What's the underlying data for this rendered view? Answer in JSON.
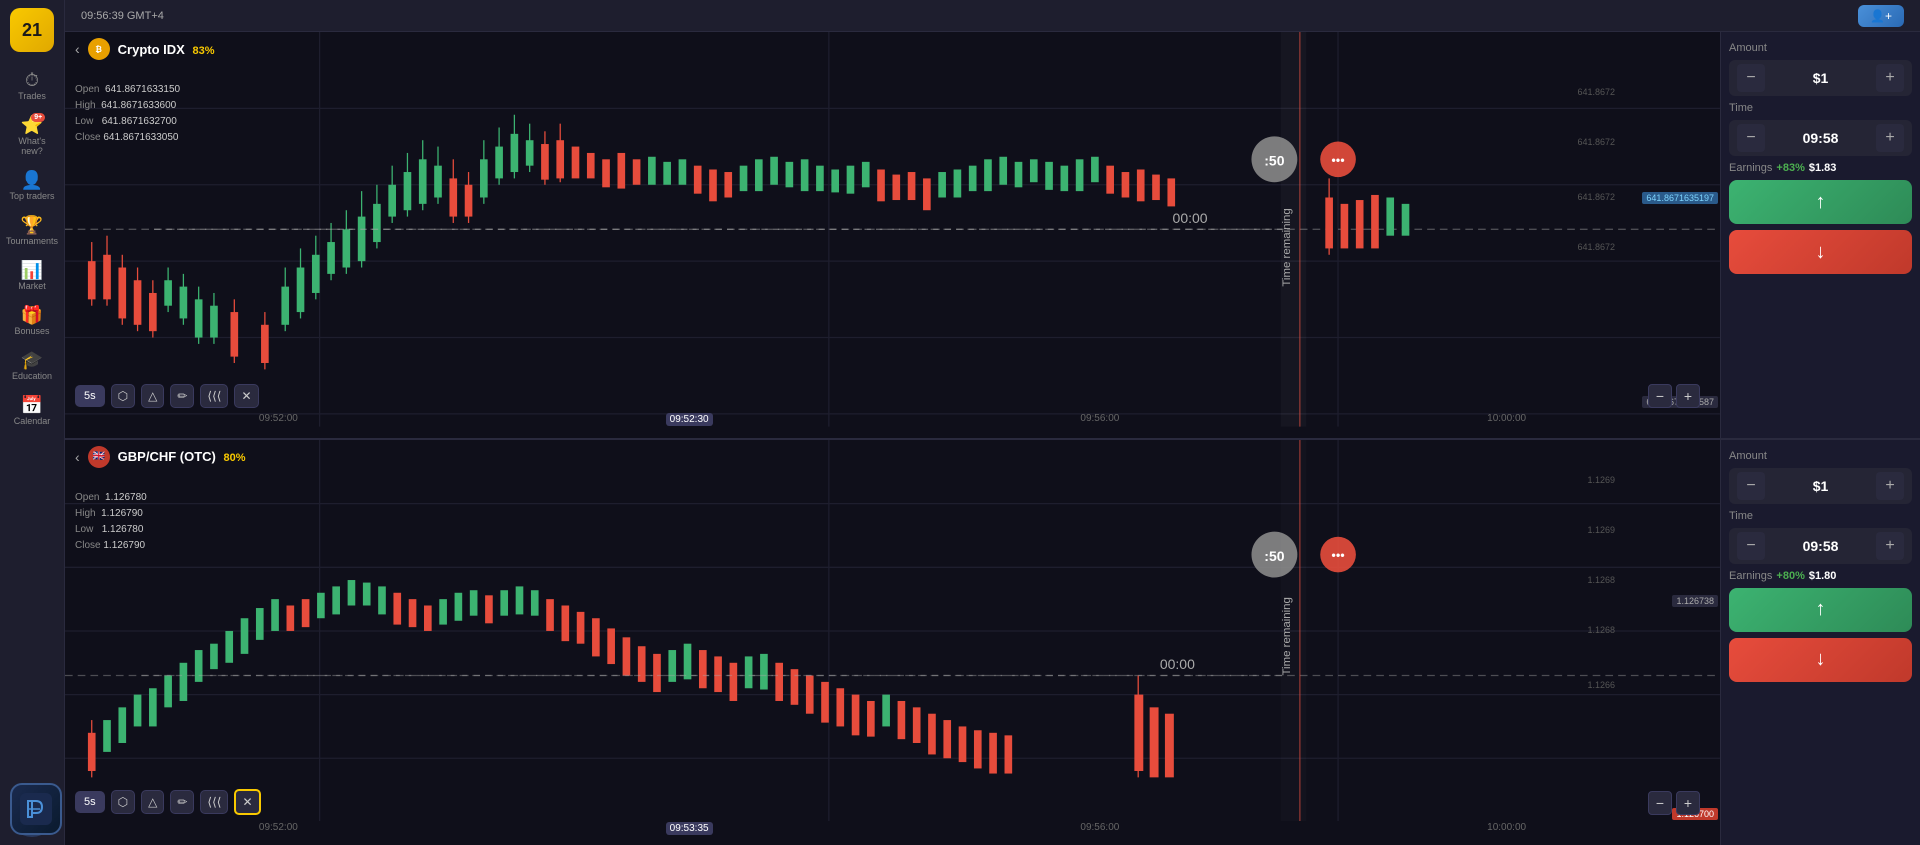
{
  "topbar": {
    "time": "09:56:39 GMT+4"
  },
  "sidebar": {
    "logo": "21",
    "items": [
      {
        "id": "trades",
        "label": "Trades",
        "icon": "⏱"
      },
      {
        "id": "whats-new",
        "label": "What's new?",
        "icon": "⭐",
        "badge": "9+"
      },
      {
        "id": "top-traders",
        "label": "Top traders",
        "icon": "👤"
      },
      {
        "id": "tournaments",
        "label": "Tournaments",
        "icon": "🏆"
      },
      {
        "id": "market",
        "label": "Market",
        "icon": "📊"
      },
      {
        "id": "bonuses",
        "label": "Bonuses",
        "icon": "🎁"
      },
      {
        "id": "education",
        "label": "Education",
        "icon": "🎓"
      },
      {
        "id": "calendar",
        "label": "Calendar",
        "icon": "📅"
      }
    ]
  },
  "charts": [
    {
      "id": "chart1",
      "asset": "Crypto IDX",
      "pct": "83%",
      "ohlc": {
        "open": "641.8671633150",
        "high": "641.8671633600",
        "low": "641.8671632700",
        "close": "641.8671633050"
      },
      "timer": ":50",
      "time_remaining": "Time remaining",
      "toolbar": {
        "timeframe": "5s",
        "indicators": "◇",
        "draw": "△",
        "pen": "✏",
        "signal": "(((",
        "close": "✕"
      },
      "price_levels": [
        "641.8672",
        "641.8672",
        "641.8672",
        "641.8672"
      ],
      "current_price": "641.8671635197",
      "current_price2": "641.8671619587",
      "time_labels": [
        "09:52:00",
        "09:52:30",
        "09:56:00",
        "10:00:00"
      ],
      "active_time": "09:52:30",
      "panel": {
        "amount_label": "Amount",
        "amount": "$1",
        "time_label": "Time",
        "time": "09:58",
        "earnings_label": "Earnings",
        "earnings_pct": "+83%",
        "earnings_val": "$1.83",
        "up_btn": "↑",
        "down_btn": "↓"
      }
    },
    {
      "id": "chart2",
      "asset": "GBP/CHF (OTC)",
      "pct": "80%",
      "ohlc": {
        "open": "1.126780",
        "high": "1.126790",
        "low": "1.126780",
        "close": "1.126790"
      },
      "timer": ":50",
      "time_remaining": "Time remaining",
      "toolbar": {
        "timeframe": "5s",
        "indicators": "◇",
        "draw": "△",
        "pen": "✏",
        "signal": "(((",
        "close": "✕"
      },
      "price_levels": [
        "1.1269",
        "1.1269",
        "1.1268",
        "1.1268",
        "1.1266"
      ],
      "current_price": "1.126738",
      "current_price2": "1.126700",
      "time_labels": [
        "09:52:00",
        "09:53:35",
        "09:56:00",
        "10:00:00"
      ],
      "active_time": "09:53:35",
      "panel": {
        "amount_label": "Amount",
        "amount": "$1",
        "time_label": "Time",
        "time": "09:58",
        "earnings_label": "Earnings",
        "earnings_pct": "+80%",
        "earnings_val": "$1.80",
        "up_btn": "↑",
        "down_btn": "↓"
      }
    }
  ],
  "user_btn": "👤+",
  "colors": {
    "up": "#3cb371",
    "down": "#e74c3c",
    "bg": "#0f0f1a",
    "sidebar": "#1e1e2e",
    "accent": "#f9c900"
  }
}
